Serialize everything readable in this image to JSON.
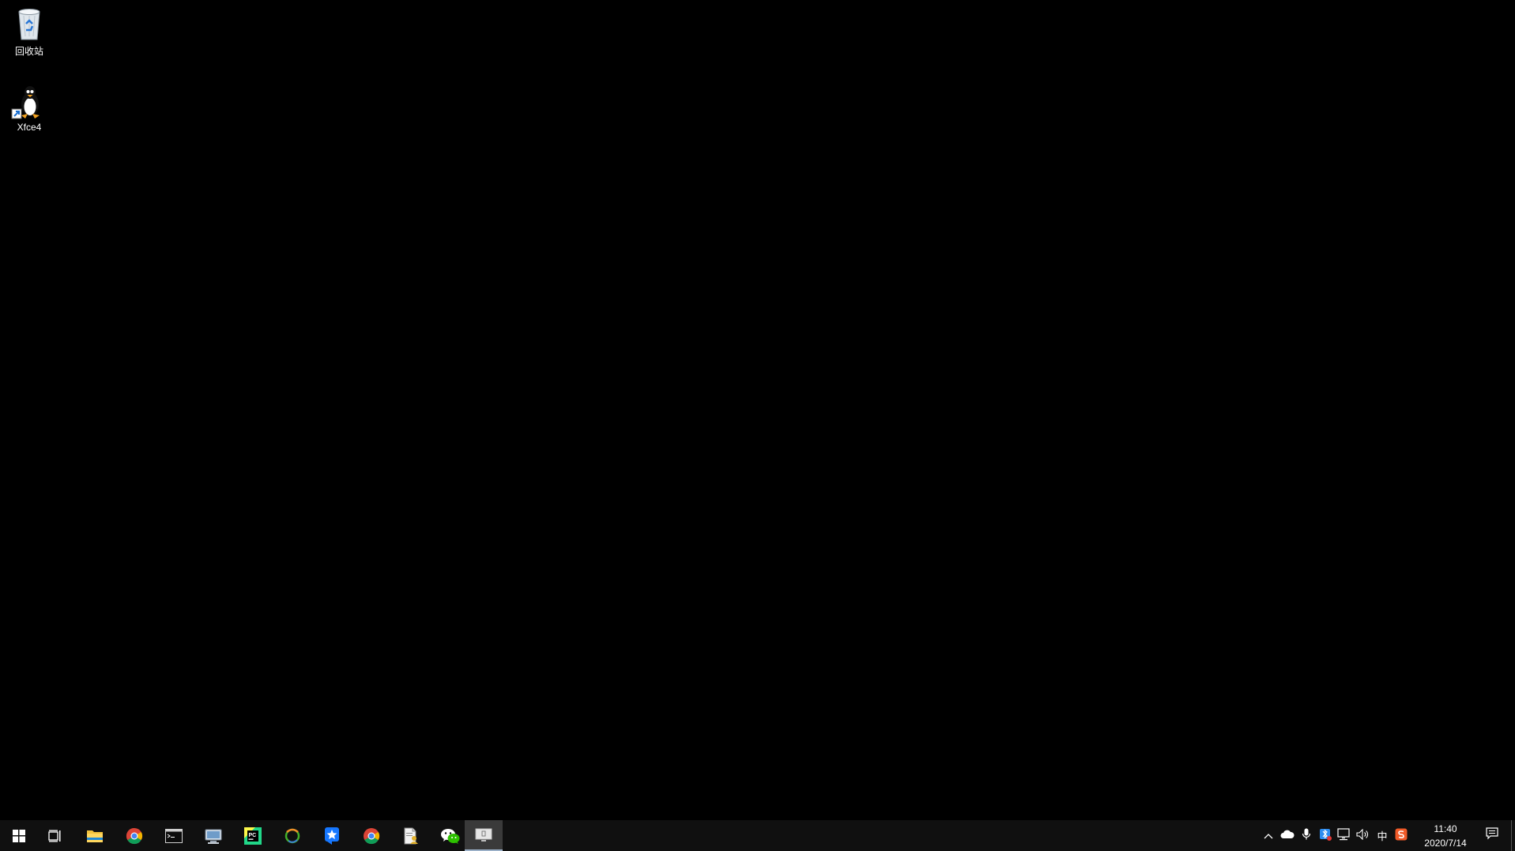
{
  "desktop": {
    "icons": [
      {
        "label": "回收站",
        "icon": "recycle-bin-icon"
      },
      {
        "label": "Xfce4",
        "icon": "linux-penguin-shortcut-icon"
      }
    ]
  },
  "taskbar": {
    "start": {
      "icon": "windows-start-icon"
    },
    "pinned": [
      {
        "icon": "task-view-icon"
      },
      {
        "icon": "file-explorer-icon"
      },
      {
        "icon": "chrome-icon"
      },
      {
        "icon": "terminal-icon"
      },
      {
        "icon": "remote-desktop-icon"
      },
      {
        "icon": "pycharm-icon",
        "text": "PC"
      },
      {
        "icon": "anaconda-icon"
      },
      {
        "icon": "star-app-icon"
      },
      {
        "icon": "chrome-icon"
      },
      {
        "icon": "document-user-icon"
      },
      {
        "icon": "wechat-icon"
      },
      {
        "icon": "display-active-icon"
      }
    ],
    "tray": {
      "items": [
        {
          "icon": "chevron-up-icon"
        },
        {
          "icon": "onedrive-cloud-icon"
        },
        {
          "icon": "microphone-icon"
        },
        {
          "icon": "bluetooth-app-icon"
        },
        {
          "icon": "network-icon"
        },
        {
          "icon": "volume-icon"
        },
        {
          "icon": "input-method-icon",
          "text": "中"
        },
        {
          "icon": "sogou-icon"
        }
      ],
      "time": "11:40",
      "date": "2020/7/14"
    },
    "notification": {
      "icon": "action-center-icon"
    }
  }
}
